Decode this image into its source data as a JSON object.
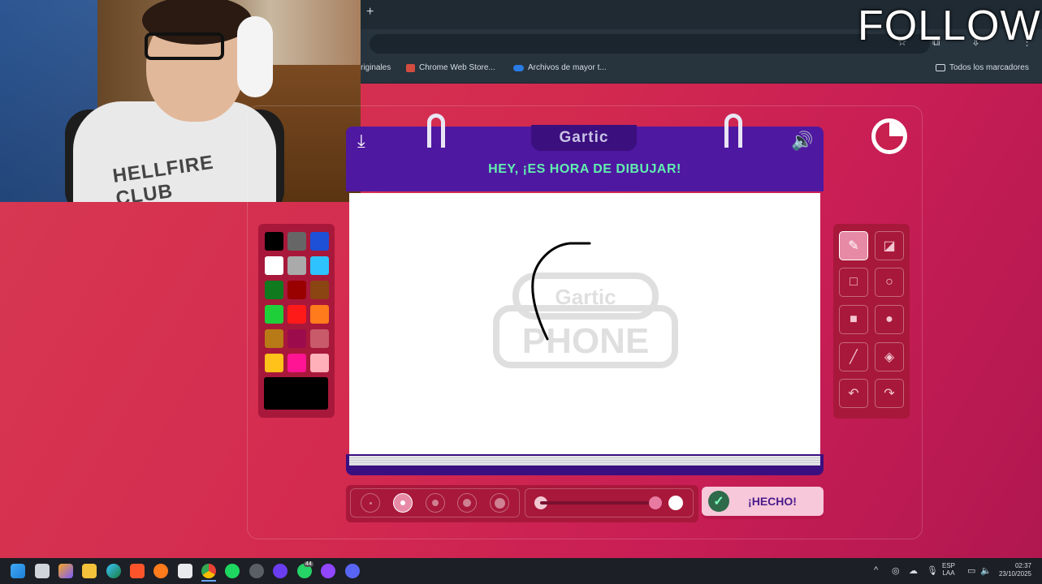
{
  "browser": {
    "new_tab_label": "+",
    "bookmarks": [
      {
        "label": "riginales"
      },
      {
        "label": "Chrome Web Store..."
      },
      {
        "label": "Archivos de mayor t..."
      }
    ],
    "all_bookmarks": "Todos los marcadores"
  },
  "overlay": {
    "follow_text": "FOLLOW"
  },
  "webcam": {
    "shirt_text": "HELLFIRE CLUB"
  },
  "game": {
    "logo": "Gartic",
    "prompt": "HEY, ¡ES HORA DE DIBUJAR!",
    "watermark_top": "Gartic",
    "watermark_bottom": "PHONE",
    "done_label": "¡HECHO!",
    "palette": [
      "#000000",
      "#666666",
      "#1d50d6",
      "#ffffff",
      "#aaaaaa",
      "#2ec3ff",
      "#0f7a1e",
      "#990000",
      "#8a4513",
      "#1ecf3a",
      "#ff1a1a",
      "#ff7b1c",
      "#b87a16",
      "#9c0c4c",
      "#c85a6a",
      "#ffc21a",
      "#ff1493",
      "#ffb0b8"
    ],
    "selected_color": "#000000",
    "tools": [
      "pencil-icon",
      "eraser-icon",
      "rectangle-outline-icon",
      "circle-outline-icon",
      "rectangle-filled-icon",
      "circle-filled-icon",
      "line-icon",
      "fill-bucket-icon",
      "undo-icon",
      "redo-icon"
    ],
    "active_tool": "pencil-icon",
    "brush_sizes": 5,
    "active_brush_index": 1,
    "opacity_fraction": 0.85
  },
  "taskbar": {
    "lang_top": "ESP",
    "lang_bottom": "LAA",
    "time": "02:37",
    "date": "23/10/2025",
    "badge": "44",
    "tray_chevron": "^"
  }
}
